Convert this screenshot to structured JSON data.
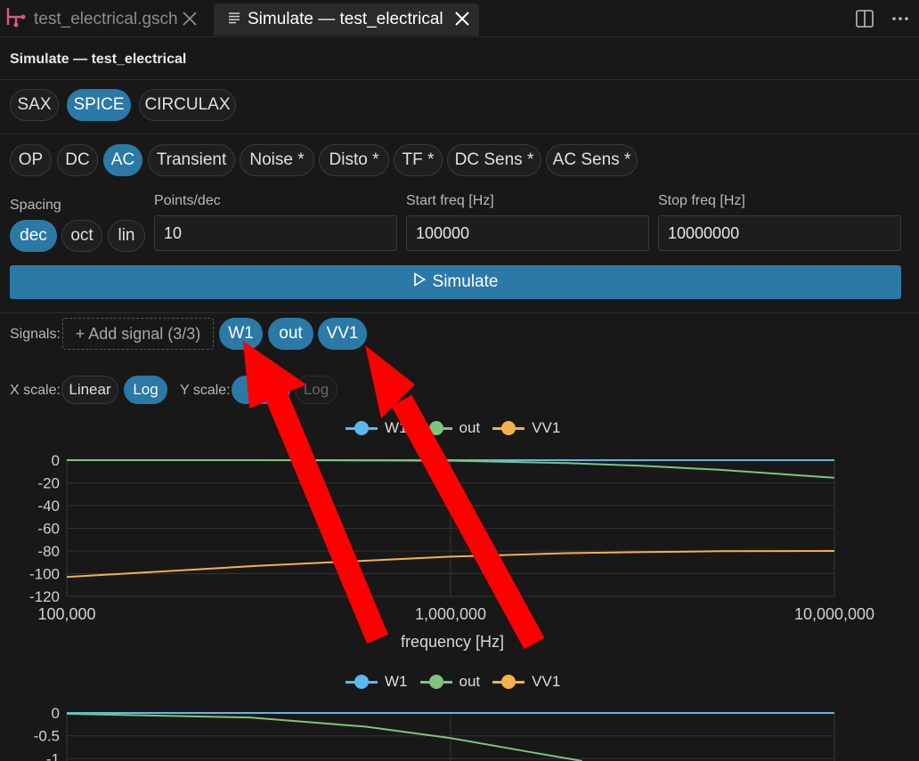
{
  "tabs": [
    {
      "label": "test_electrical.gsch",
      "active": false
    },
    {
      "label": "Simulate — test_electrical",
      "active": true
    }
  ],
  "panel_title": "Simulate — test_electrical",
  "backends": [
    "SAX",
    "SPICE",
    "CIRCULAX"
  ],
  "backend_selected": "SPICE",
  "analyses": [
    "OP",
    "DC",
    "AC",
    "Transient",
    "Noise *",
    "Disto *",
    "TF *",
    "DC Sens *",
    "AC Sens *"
  ],
  "analysis_selected": "AC",
  "spacing": {
    "label": "Spacing",
    "options": [
      "dec",
      "oct",
      "lin"
    ],
    "selected": "dec"
  },
  "points_per_dec": {
    "label": "Points/dec",
    "value": "10"
  },
  "start_freq": {
    "label": "Start freq [Hz]",
    "value": "100000"
  },
  "stop_freq": {
    "label": "Stop freq [Hz]",
    "value": "10000000"
  },
  "simulate_label": "Simulate",
  "signals": {
    "label": "Signals:",
    "add_label": "+ Add signal (3/3)",
    "chips": [
      "W1",
      "out",
      "VV1"
    ]
  },
  "x_scale": {
    "label": "X scale:",
    "options": [
      "Linear",
      "Log"
    ],
    "selected": "Log"
  },
  "y_scale": {
    "label": "Y scale:",
    "options": [
      "Linear",
      "Log"
    ],
    "selected": "Linear",
    "visible_partial": "Li"
  },
  "colors": {
    "accent": "#2b79a6",
    "W1": "#5ab8f0",
    "out": "#7ec47e",
    "VV1": "#f5b14c",
    "annotation_arrow": "#ff0000"
  },
  "chart_data": [
    {
      "type": "line",
      "xlabel": "frequency [Hz]",
      "x_scale": "log",
      "xlim": [
        100000,
        10000000
      ],
      "x_ticks": [
        "100,000",
        "1,000,000",
        "10,000,000"
      ],
      "ylim": [
        -120,
        0
      ],
      "y_ticks": [
        "0",
        "-20",
        "-40",
        "-60",
        "-80",
        "-100",
        "-120"
      ],
      "grid": true,
      "legend": "top-center",
      "series": [
        {
          "name": "W1",
          "x": [
            100000,
            316228,
            1000000,
            3162278,
            10000000
          ],
          "y": [
            0,
            0,
            0,
            0,
            0
          ]
        },
        {
          "name": "out",
          "x": [
            100000,
            316228,
            1000000,
            2000000,
            3162278,
            5000000,
            10000000
          ],
          "y": [
            0,
            0,
            -0.5,
            -2.5,
            -5,
            -8.5,
            -15.5
          ]
        },
        {
          "name": "VV1",
          "x": [
            100000,
            316228,
            1000000,
            2000000,
            3162278,
            5000000,
            10000000
          ],
          "y": [
            -103,
            -93,
            -85,
            -82,
            -81,
            -80.2,
            -80
          ]
        }
      ]
    },
    {
      "type": "line",
      "x_scale": "log",
      "xlim": [
        100000,
        10000000
      ],
      "y_ticks": [
        "0",
        "-0.5",
        "-1"
      ],
      "ylim": [
        -1.05,
        0
      ],
      "grid": true,
      "legend": "top-center",
      "series": [
        {
          "name": "W1",
          "x": [
            100000,
            10000000
          ],
          "y": [
            0,
            0
          ]
        },
        {
          "name": "out",
          "x": [
            100000,
            300000,
            600000,
            1000000,
            1600000,
            2200000
          ],
          "y": [
            -0.02,
            -0.1,
            -0.3,
            -0.55,
            -0.85,
            -1.05
          ]
        },
        {
          "name": "VV1",
          "x": [],
          "y": []
        }
      ]
    }
  ]
}
